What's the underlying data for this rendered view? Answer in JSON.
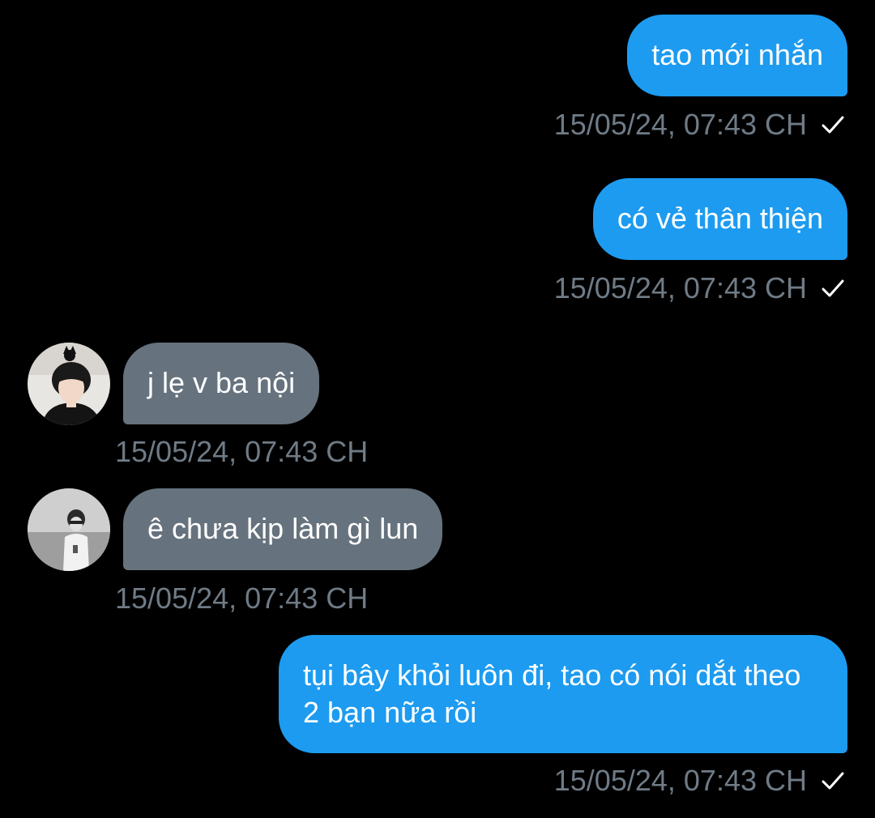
{
  "messages": [
    {
      "direction": "sent",
      "text": "tao mới nhắn",
      "time": "15/05/24, 07:43 CH",
      "status_icon": "check-icon"
    },
    {
      "direction": "sent",
      "text": "có vẻ thân thiện",
      "time": "15/05/24, 07:43 CH",
      "status_icon": "check-icon"
    },
    {
      "direction": "received",
      "text": "j lẹ v ba nội",
      "time": "15/05/24, 07:43 CH",
      "avatar": "avatar-1"
    },
    {
      "direction": "received",
      "text": "ê chưa kịp làm gì lun",
      "time": "15/05/24, 07:43 CH",
      "avatar": "avatar-2"
    },
    {
      "direction": "sent",
      "text": "tụi bây khỏi luôn đi, tao có nói dắt theo 2 bạn nữa rồi",
      "time": "15/05/24, 07:43 CH",
      "status_icon": "check-icon"
    }
  ],
  "colors": {
    "sent_bubble": "#1d9bf0",
    "received_bubble": "#66727d",
    "timestamp": "#6f7b86",
    "background": "#000000"
  }
}
